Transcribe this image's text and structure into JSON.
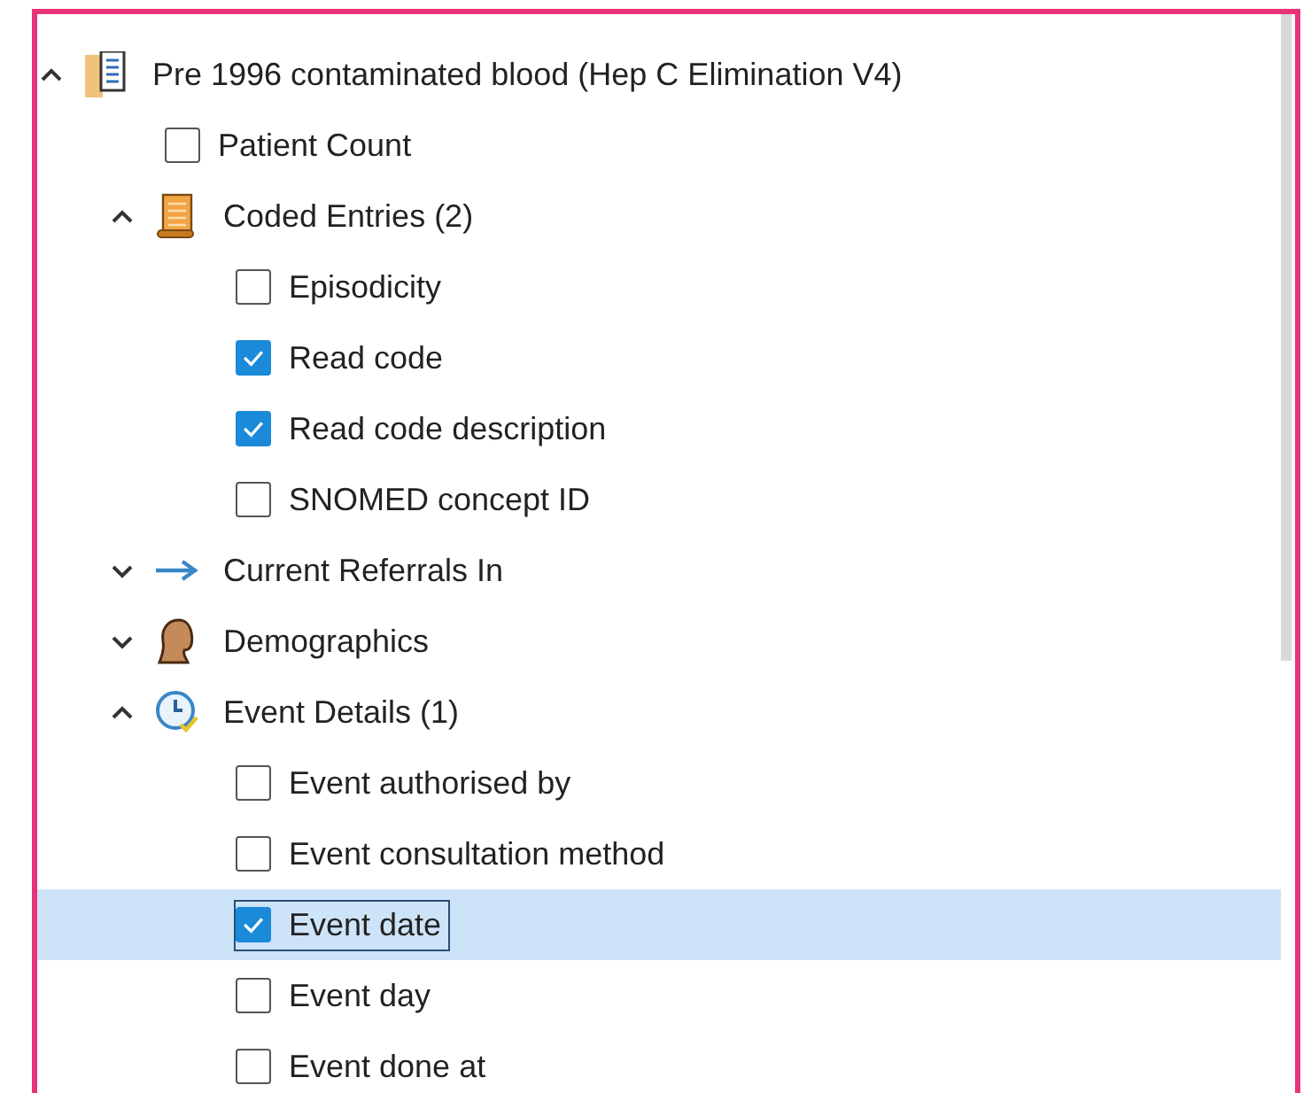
{
  "tree": [
    {
      "kind": "group",
      "label": "Pre 1996 contaminated blood (Hep C Elimination V4)",
      "expanded": true,
      "children": [
        {
          "kind": "field",
          "label": "Patient Count",
          "checked": false,
          "selected": false
        },
        {
          "kind": "group",
          "label": "Coded Entries (2)",
          "expanded": true,
          "children": [
            {
              "kind": "field",
              "label": "Episodicity",
              "checked": false,
              "selected": false
            },
            {
              "kind": "field",
              "label": "Read code",
              "checked": true,
              "selected": false
            },
            {
              "kind": "field",
              "label": "Read code description",
              "checked": true,
              "selected": false
            },
            {
              "kind": "field",
              "label": "SNOMED concept ID",
              "checked": false,
              "selected": false
            }
          ]
        },
        {
          "kind": "group",
          "label": "Current Referrals In",
          "expanded": false
        },
        {
          "kind": "group",
          "label": "Demographics",
          "expanded": false
        },
        {
          "kind": "group",
          "label": "Event Details (1)",
          "expanded": true,
          "children": [
            {
              "kind": "field",
              "label": "Event authorised by",
              "checked": false,
              "selected": false
            },
            {
              "kind": "field",
              "label": "Event consultation method",
              "checked": false,
              "selected": false
            },
            {
              "kind": "field",
              "label": "Event date",
              "checked": true,
              "selected": true
            },
            {
              "kind": "field",
              "label": "Event day",
              "checked": false,
              "selected": false
            },
            {
              "kind": "field",
              "label": "Event done at",
              "checked": false,
              "selected": false
            }
          ]
        }
      ]
    }
  ]
}
